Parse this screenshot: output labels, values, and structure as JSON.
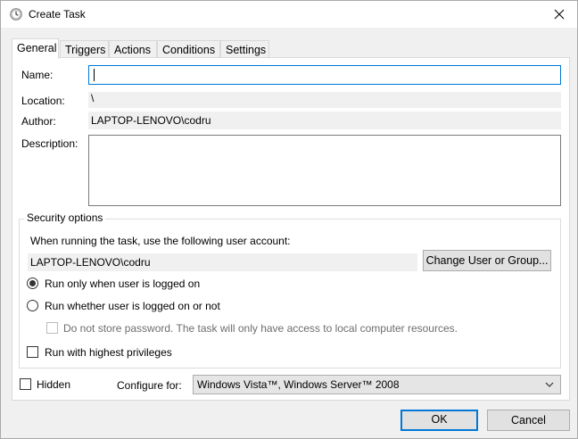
{
  "window": {
    "title": "Create Task",
    "close_glyph": "✕"
  },
  "tabs": [
    {
      "label": "General",
      "active": true
    },
    {
      "label": "Triggers",
      "active": false
    },
    {
      "label": "Actions",
      "active": false
    },
    {
      "label": "Conditions",
      "active": false
    },
    {
      "label": "Settings",
      "active": false
    }
  ],
  "general": {
    "name_label": "Name:",
    "name_value": "",
    "location_label": "Location:",
    "location_value": "\\",
    "author_label": "Author:",
    "author_value": "LAPTOP-LENOVO\\codru",
    "description_label": "Description:",
    "description_value": ""
  },
  "security": {
    "title": "Security options",
    "account_prompt": "When running the task, use the following user account:",
    "account_value": "LAPTOP-LENOVO\\codru",
    "change_button": "Change User or Group...",
    "radio_logged_on": "Run only when user is logged on",
    "radio_whether": "Run whether user is logged on or not",
    "no_store_password": "Do not store password.  The task will only have access to local computer resources.",
    "highest_privileges": "Run with highest privileges",
    "selected_radio": "logged_on"
  },
  "footer": {
    "hidden_label": "Hidden",
    "configure_label": "Configure for:",
    "configure_value": "Windows Vista™, Windows Server™ 2008"
  },
  "buttons": {
    "ok": "OK",
    "cancel": "Cancel"
  },
  "colors": {
    "accent": "#0078d7",
    "dialog_bg": "#f0f0f0",
    "button_bg": "#e1e1e1"
  }
}
